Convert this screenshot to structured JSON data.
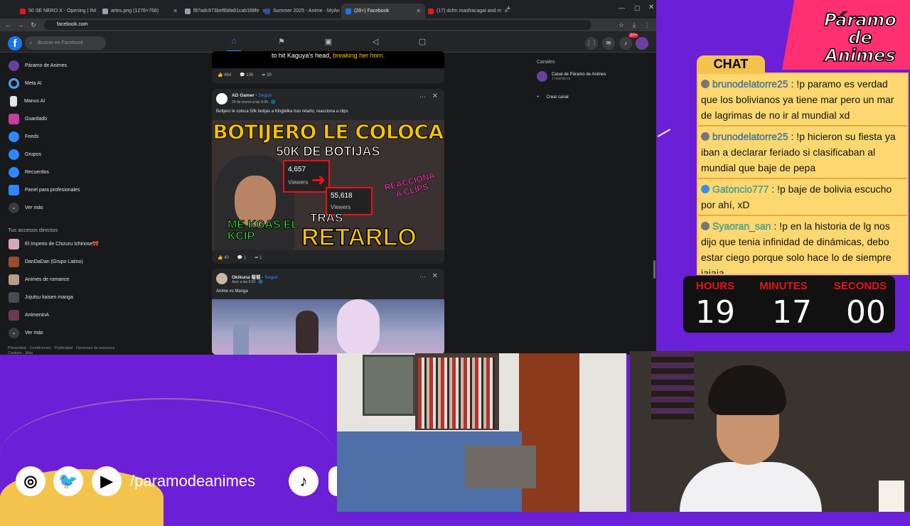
{
  "browser": {
    "tabs": [
      {
        "label": "50 SE NERO X - Opening | INI",
        "color": "#e11a1a",
        "active": false
      },
      {
        "label": "artes.png (1276×768)",
        "color": "#9aa0a6",
        "active": false
      },
      {
        "label": "f87adc973bef6bfa91cab168fe",
        "color": "#9aa0a6",
        "active": false
      },
      {
        "label": "Summer 2025 - Anime - MyAn",
        "color": "#2e51a2",
        "active": false
      },
      {
        "label": "(28+) Facebook",
        "color": "#1877f2",
        "active": true
      },
      {
        "label": "(17) dcfm masfracagal and m",
        "color": "#e11a1a",
        "active": false
      }
    ],
    "url": "facebook.com"
  },
  "fb": {
    "search_placeholder": "Buscar en Facebook",
    "notif_badge": "20+",
    "left_items": [
      "Páramo de Animes",
      "Meta AI",
      "Manus AI",
      "Guardado",
      "Feeds",
      "Grupos",
      "Recuerdos",
      "Panel para profesionales",
      "Ver más"
    ],
    "shortcuts_header": "Tus accesos directos",
    "shortcuts": [
      "El Imperio de Chizuru Ichinose🎀",
      "DanDaDan (Grupo Latino)",
      "Animes de romance",
      "Jujutsu kaisen manga",
      "AnimeninA",
      "Ver más"
    ],
    "footer": "Privacidad · Condiciones · Publicidad · Opciones de anuncios · Cookies · Más"
  },
  "post0": {
    "caption_a": "to hit Kaguya's head,",
    "caption_b": "breaking her horn.",
    "likes": "464",
    "comments": "136",
    "shares": "39"
  },
  "post1": {
    "author": "AD Gamer",
    "follow": "Seguir",
    "date": "29 de marzo a las 9:35 · 🌐",
    "text": "Botijero le coloca 50k botijas a Kingtelka tras retarlo, reacciona a clips",
    "thumb": {
      "line1": "BOTIJERO LE COLOCA",
      "line2": "50K DE BOTIJAS",
      "stat1_num": "4,657",
      "stat1_label": "Viewers",
      "stat2_num": "55,618",
      "stat2_label": "Viewers",
      "reacciona": "REACCIONA A CLIPS",
      "mekgas": "ME KGAS EL KCIP",
      "tras": "TRAS",
      "retarlo": "RETARLO"
    },
    "likes": "40",
    "comments": "1",
    "shares": "1"
  },
  "post2": {
    "author": "Okikuna 菊菊",
    "follow": "Seguir",
    "date": "Ayer a las 9:03 · 🌐",
    "text": "Anime vs Manga"
  },
  "right": {
    "channels_header": "Canales",
    "channel_name": "Canal de Páramo de Animes",
    "channel_members": "1 miembros",
    "create": "Crear canal"
  },
  "stream": {
    "brand": "Páramo de Animes",
    "chat_label": "CHAT",
    "chat": [
      {
        "user": "brunodelatorre25",
        "text": ": !p paramo es verdad que los bolivianos ya tiene mar pero un mar de lagrimas de no ir al mundial xd",
        "color": "#3b8ee6"
      },
      {
        "user": "brunodelatorre25",
        "text": ": !p hicieron su fiesta ya iban a declarar feriado si clasificaban al mundial que baje de pepa",
        "color": "#3b8ee6"
      },
      {
        "user": "Gatoncio777",
        "text": ": !p baje de bolivia escucho por ahí, xD",
        "color": "#35d7d2"
      },
      {
        "user": "Syaoran_san",
        "text": ": !p en la historia de lg nos dijo que tenia infinidad de dinámicas, debo estar ciego porque solo hace lo de siempre jajaja",
        "color": "#35d7d2"
      }
    ],
    "timer": {
      "hours_label": "HOURS",
      "minutes_label": "MINUTES",
      "seconds_label": "SECONDS",
      "hours": "19",
      "minutes": "17",
      "seconds": "00"
    },
    "handle": "/paramodeanimes"
  }
}
